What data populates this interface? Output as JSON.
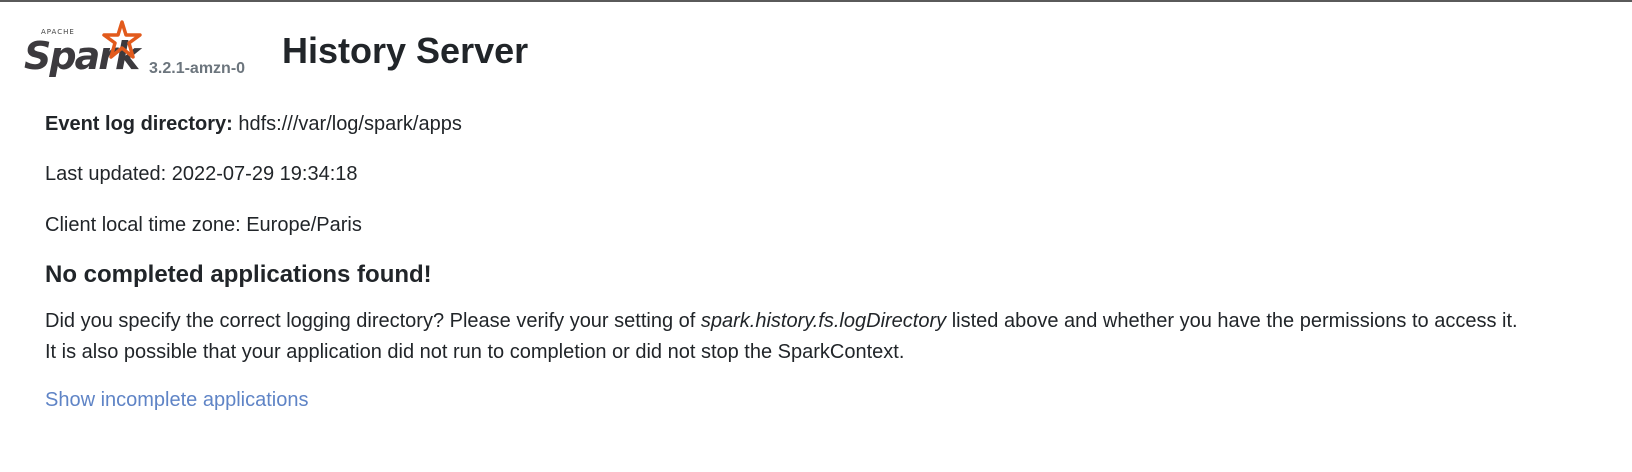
{
  "header": {
    "logo": {
      "apache_text": "APACHE",
      "spark_text": "Spark",
      "star_icon": "spark-star-icon",
      "star_color": "#e25a1c"
    },
    "version": "3.2.1-amzn-0",
    "title": "History Server"
  },
  "info": {
    "event_log_label": "Event log directory:",
    "event_log_value": "hdfs:///var/log/spark/apps",
    "last_updated_label": "Last updated:",
    "last_updated_value": "2022-07-29 19:34:18",
    "timezone_label": "Client local time zone:",
    "timezone_value": "Europe/Paris"
  },
  "empty_state": {
    "heading": "No completed applications found!",
    "message_part1": "Did you specify the correct logging directory? Please verify your setting of ",
    "message_setting": "spark.history.fs.logDirectory",
    "message_part2": " listed above and whether you have the permissions to access it.",
    "message_line2": "It is also possible that your application did not run to completion or did not stop the SparkContext."
  },
  "actions": {
    "show_incomplete_label": "Show incomplete applications"
  },
  "colors": {
    "link": "#5f84c6",
    "version": "#6c757d",
    "text": "#212529",
    "top_border": "#5a5a5a"
  }
}
